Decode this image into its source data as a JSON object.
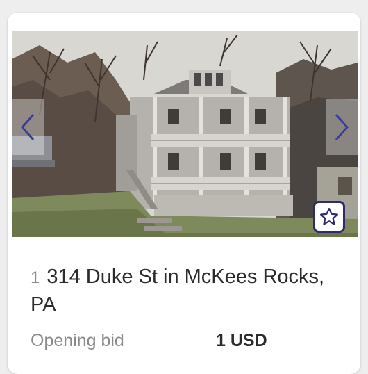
{
  "listing": {
    "index": "1",
    "title": "314 Duke St in McKees Rocks, PA",
    "bid_label": "Opening bid",
    "bid_value": "1 USD"
  },
  "photo": {
    "description_icon": "house-photo"
  },
  "icons": {
    "prev": "chevron-left-icon",
    "next": "chevron-right-icon",
    "favorite": "star-outline-icon"
  },
  "colors": {
    "accent": "#2f2a6e",
    "arrow": "#3a3d9c",
    "muted_text": "#8a8a8a",
    "body_text": "#2b2b2b"
  }
}
